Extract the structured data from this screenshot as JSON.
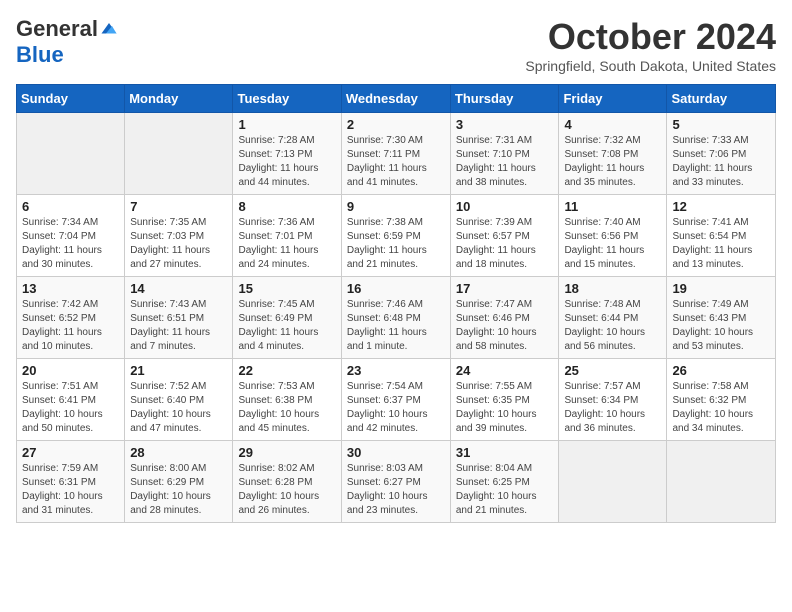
{
  "header": {
    "logo_general": "General",
    "logo_blue": "Blue",
    "month": "October 2024",
    "location": "Springfield, South Dakota, United States"
  },
  "days_of_week": [
    "Sunday",
    "Monday",
    "Tuesday",
    "Wednesday",
    "Thursday",
    "Friday",
    "Saturday"
  ],
  "weeks": [
    [
      {
        "day": "",
        "info": ""
      },
      {
        "day": "",
        "info": ""
      },
      {
        "day": "1",
        "info": "Sunrise: 7:28 AM\nSunset: 7:13 PM\nDaylight: 11 hours and 44 minutes."
      },
      {
        "day": "2",
        "info": "Sunrise: 7:30 AM\nSunset: 7:11 PM\nDaylight: 11 hours and 41 minutes."
      },
      {
        "day": "3",
        "info": "Sunrise: 7:31 AM\nSunset: 7:10 PM\nDaylight: 11 hours and 38 minutes."
      },
      {
        "day": "4",
        "info": "Sunrise: 7:32 AM\nSunset: 7:08 PM\nDaylight: 11 hours and 35 minutes."
      },
      {
        "day": "5",
        "info": "Sunrise: 7:33 AM\nSunset: 7:06 PM\nDaylight: 11 hours and 33 minutes."
      }
    ],
    [
      {
        "day": "6",
        "info": "Sunrise: 7:34 AM\nSunset: 7:04 PM\nDaylight: 11 hours and 30 minutes."
      },
      {
        "day": "7",
        "info": "Sunrise: 7:35 AM\nSunset: 7:03 PM\nDaylight: 11 hours and 27 minutes."
      },
      {
        "day": "8",
        "info": "Sunrise: 7:36 AM\nSunset: 7:01 PM\nDaylight: 11 hours and 24 minutes."
      },
      {
        "day": "9",
        "info": "Sunrise: 7:38 AM\nSunset: 6:59 PM\nDaylight: 11 hours and 21 minutes."
      },
      {
        "day": "10",
        "info": "Sunrise: 7:39 AM\nSunset: 6:57 PM\nDaylight: 11 hours and 18 minutes."
      },
      {
        "day": "11",
        "info": "Sunrise: 7:40 AM\nSunset: 6:56 PM\nDaylight: 11 hours and 15 minutes."
      },
      {
        "day": "12",
        "info": "Sunrise: 7:41 AM\nSunset: 6:54 PM\nDaylight: 11 hours and 13 minutes."
      }
    ],
    [
      {
        "day": "13",
        "info": "Sunrise: 7:42 AM\nSunset: 6:52 PM\nDaylight: 11 hours and 10 minutes."
      },
      {
        "day": "14",
        "info": "Sunrise: 7:43 AM\nSunset: 6:51 PM\nDaylight: 11 hours and 7 minutes."
      },
      {
        "day": "15",
        "info": "Sunrise: 7:45 AM\nSunset: 6:49 PM\nDaylight: 11 hours and 4 minutes."
      },
      {
        "day": "16",
        "info": "Sunrise: 7:46 AM\nSunset: 6:48 PM\nDaylight: 11 hours and 1 minute."
      },
      {
        "day": "17",
        "info": "Sunrise: 7:47 AM\nSunset: 6:46 PM\nDaylight: 10 hours and 58 minutes."
      },
      {
        "day": "18",
        "info": "Sunrise: 7:48 AM\nSunset: 6:44 PM\nDaylight: 10 hours and 56 minutes."
      },
      {
        "day": "19",
        "info": "Sunrise: 7:49 AM\nSunset: 6:43 PM\nDaylight: 10 hours and 53 minutes."
      }
    ],
    [
      {
        "day": "20",
        "info": "Sunrise: 7:51 AM\nSunset: 6:41 PM\nDaylight: 10 hours and 50 minutes."
      },
      {
        "day": "21",
        "info": "Sunrise: 7:52 AM\nSunset: 6:40 PM\nDaylight: 10 hours and 47 minutes."
      },
      {
        "day": "22",
        "info": "Sunrise: 7:53 AM\nSunset: 6:38 PM\nDaylight: 10 hours and 45 minutes."
      },
      {
        "day": "23",
        "info": "Sunrise: 7:54 AM\nSunset: 6:37 PM\nDaylight: 10 hours and 42 minutes."
      },
      {
        "day": "24",
        "info": "Sunrise: 7:55 AM\nSunset: 6:35 PM\nDaylight: 10 hours and 39 minutes."
      },
      {
        "day": "25",
        "info": "Sunrise: 7:57 AM\nSunset: 6:34 PM\nDaylight: 10 hours and 36 minutes."
      },
      {
        "day": "26",
        "info": "Sunrise: 7:58 AM\nSunset: 6:32 PM\nDaylight: 10 hours and 34 minutes."
      }
    ],
    [
      {
        "day": "27",
        "info": "Sunrise: 7:59 AM\nSunset: 6:31 PM\nDaylight: 10 hours and 31 minutes."
      },
      {
        "day": "28",
        "info": "Sunrise: 8:00 AM\nSunset: 6:29 PM\nDaylight: 10 hours and 28 minutes."
      },
      {
        "day": "29",
        "info": "Sunrise: 8:02 AM\nSunset: 6:28 PM\nDaylight: 10 hours and 26 minutes."
      },
      {
        "day": "30",
        "info": "Sunrise: 8:03 AM\nSunset: 6:27 PM\nDaylight: 10 hours and 23 minutes."
      },
      {
        "day": "31",
        "info": "Sunrise: 8:04 AM\nSunset: 6:25 PM\nDaylight: 10 hours and 21 minutes."
      },
      {
        "day": "",
        "info": ""
      },
      {
        "day": "",
        "info": ""
      }
    ]
  ]
}
